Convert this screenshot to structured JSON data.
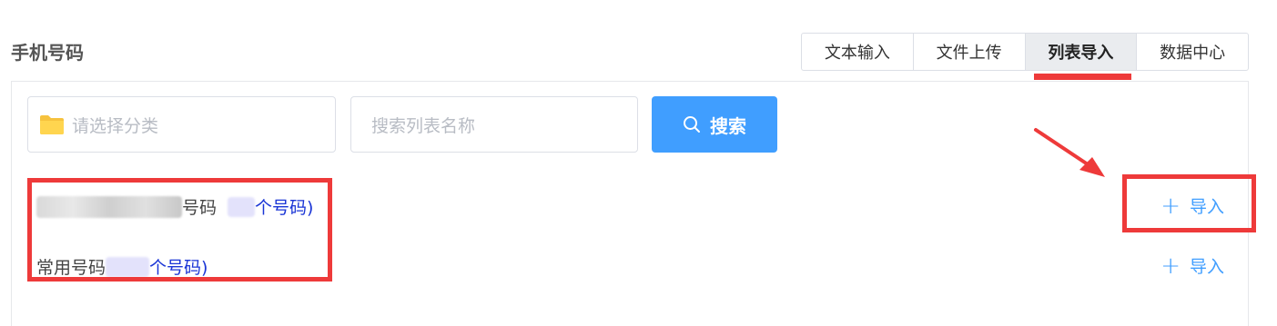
{
  "section": {
    "title": "手机号码"
  },
  "tabs": [
    {
      "label": "文本输入",
      "active": false
    },
    {
      "label": "文件上传",
      "active": false
    },
    {
      "label": "列表导入",
      "active": true
    },
    {
      "label": "数据中心",
      "active": false
    }
  ],
  "filters": {
    "category_placeholder": "请选择分类",
    "search_placeholder": "搜索列表名称",
    "search_button": "搜索"
  },
  "lists": [
    {
      "name_suffix": "号码",
      "count_suffix": "个号码)",
      "import_label": "导入"
    },
    {
      "name": "常用号码",
      "count_suffix": "个号码)",
      "import_label": "导入"
    }
  ],
  "colors": {
    "primary": "#409eff",
    "highlight": "#ee3a3a",
    "count_text": "#1a35d6",
    "folder": "#f6c23e"
  },
  "icons": {
    "category": "folder-icon",
    "search": "search-icon",
    "import": "plus-icon",
    "annotation": "arrow-icon"
  }
}
